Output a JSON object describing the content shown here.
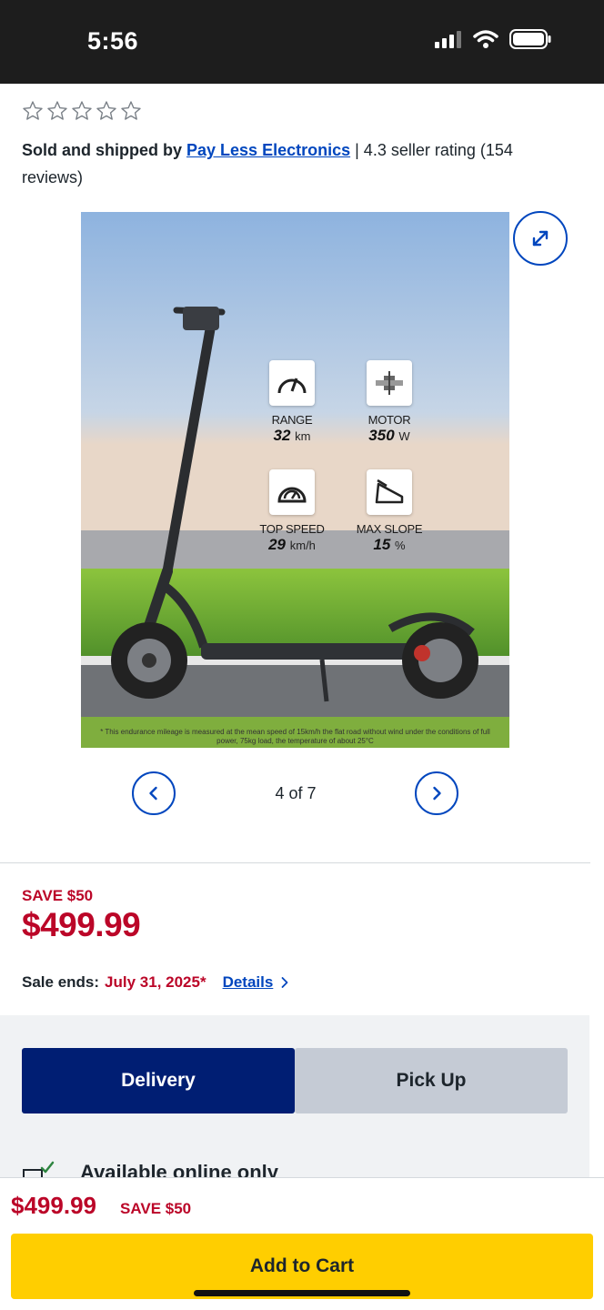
{
  "status_bar": {
    "time": "5:56"
  },
  "rating": {
    "stars_filled": 0,
    "stars_total": 5
  },
  "seller": {
    "lead": "Sold and shipped by ",
    "name": "Pay Less Electronics",
    "rating_text": " | 4.3 seller rating (154 reviews)"
  },
  "gallery": {
    "specs": [
      {
        "label": "RANGE",
        "value": "32",
        "unit": "km",
        "icon": "speedometer-icon"
      },
      {
        "label": "MOTOR",
        "value": "350",
        "unit": "W",
        "icon": "motor-icon"
      },
      {
        "label": "TOP SPEED",
        "value": "29",
        "unit": "km/h",
        "icon": "speed-gauge-icon"
      },
      {
        "label": "MAX SLOPE",
        "value": "15",
        "unit": "%",
        "icon": "slope-icon"
      }
    ],
    "disclaimer": "* This endurance mileage is measured at the mean speed of 15km/h the flat road without wind under the conditions of full power, 75kg load, the temperature of about 25°C",
    "counter": "4 of 7"
  },
  "pricing": {
    "save_tag": "SAVE $50",
    "price": "$499.99",
    "sale_ends_label": "Sale ends:",
    "sale_ends_date": "July 31, 2025*",
    "details_link": "Details"
  },
  "fulfillment": {
    "tabs": [
      {
        "label": "Delivery",
        "selected": true
      },
      {
        "label": "Pick Up",
        "selected": false
      }
    ],
    "availability": "Available online only"
  },
  "bottom_bar": {
    "price": "$499.99",
    "save_tag": "SAVE $50",
    "cta": "Add to Cart"
  },
  "colors": {
    "sale_red": "#bb0628",
    "link_blue": "#0046be",
    "tab_selected": "#001e73",
    "cta_yellow": "#ffce00"
  }
}
